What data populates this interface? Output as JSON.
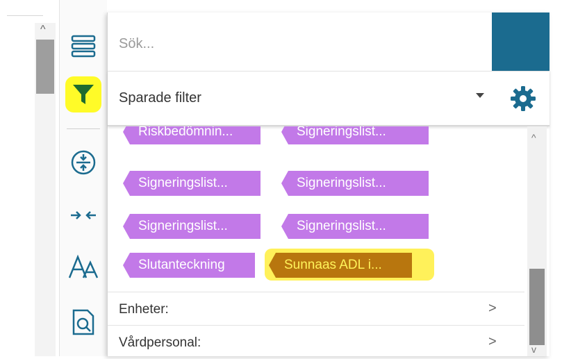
{
  "search": {
    "placeholder": "Sök..."
  },
  "filter": {
    "label": "Sparade filter"
  },
  "tags": [
    "Riskbedömnin...",
    "Signeringslist...",
    "Signeringslist...",
    "Signeringslist...",
    "Signeringslist...",
    "Signeringslist...",
    "Slutanteckning",
    "Sunnaas ADL i..."
  ],
  "rows": [
    {
      "label": "Enheter:",
      "chevron": ">"
    },
    {
      "label": "Vårdpersonal:",
      "chevron": ">"
    }
  ],
  "scroll": {
    "up": "^",
    "down": "v"
  },
  "colors": {
    "tag": "#c279e8",
    "highlight_tag": "#b8760e",
    "accent": "#1b6b8f",
    "highlighter": "#fffb28"
  },
  "icons": [
    "list-icon",
    "filter-icon",
    "collapse-icon",
    "merge-arrows-icon",
    "font-size-icon",
    "document-search-icon",
    "gear-icon"
  ]
}
